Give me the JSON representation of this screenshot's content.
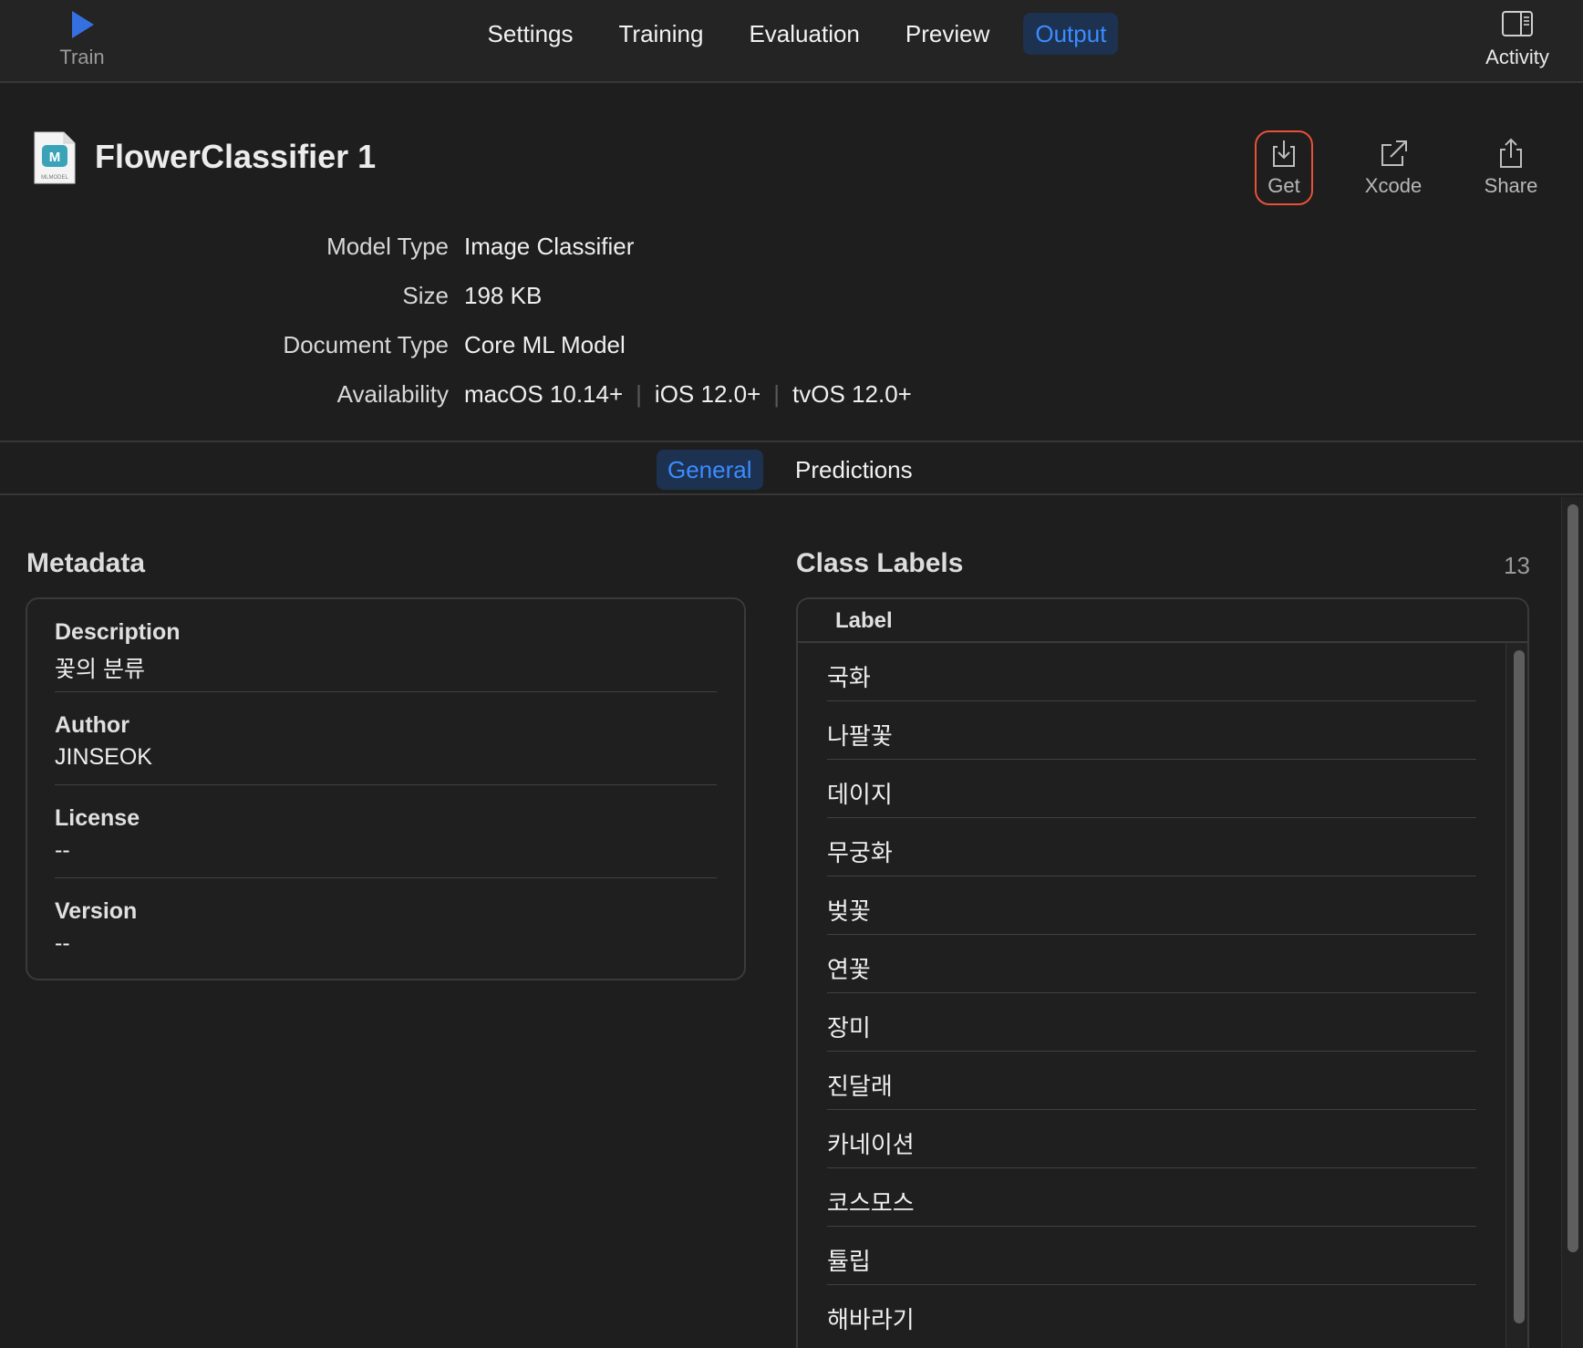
{
  "toolbar": {
    "train_label": "Train",
    "tabs": [
      {
        "label": "Settings"
      },
      {
        "label": "Training"
      },
      {
        "label": "Evaluation"
      },
      {
        "label": "Preview"
      },
      {
        "label": "Output",
        "active": true
      }
    ],
    "activity_label": "Activity"
  },
  "model": {
    "name": "FlowerClassifier 1",
    "icon_caption": "MLMODEL",
    "actions": {
      "get": "Get",
      "xcode": "Xcode",
      "share": "Share"
    },
    "info": {
      "model_type_key": "Model Type",
      "model_type": "Image Classifier",
      "size_key": "Size",
      "size": "198 KB",
      "document_type_key": "Document Type",
      "document_type": "Core ML Model",
      "availability_key": "Availability",
      "availability": [
        "macOS 10.14+",
        "iOS 12.0+",
        "tvOS 12.0+"
      ]
    }
  },
  "subtabs": {
    "general": "General",
    "predictions": "Predictions"
  },
  "metadata": {
    "title": "Metadata",
    "items": [
      {
        "key": "Description",
        "value": "꽃의 분류"
      },
      {
        "key": "Author",
        "value": "JINSEOK"
      },
      {
        "key": "License",
        "value": "--"
      },
      {
        "key": "Version",
        "value": "--"
      }
    ]
  },
  "class_labels": {
    "title": "Class Labels",
    "count": "13",
    "column_header": "Label",
    "labels": [
      "국화",
      "나팔꽃",
      "데이지",
      "무궁화",
      "벚꽃",
      "연꽃",
      "장미",
      "진달래",
      "카네이션",
      "코스모스",
      "튤립",
      "해바라기"
    ]
  },
  "colors": {
    "accent": "#3b8cff",
    "highlight_border": "#e8503a",
    "background": "#1e1e1e"
  }
}
